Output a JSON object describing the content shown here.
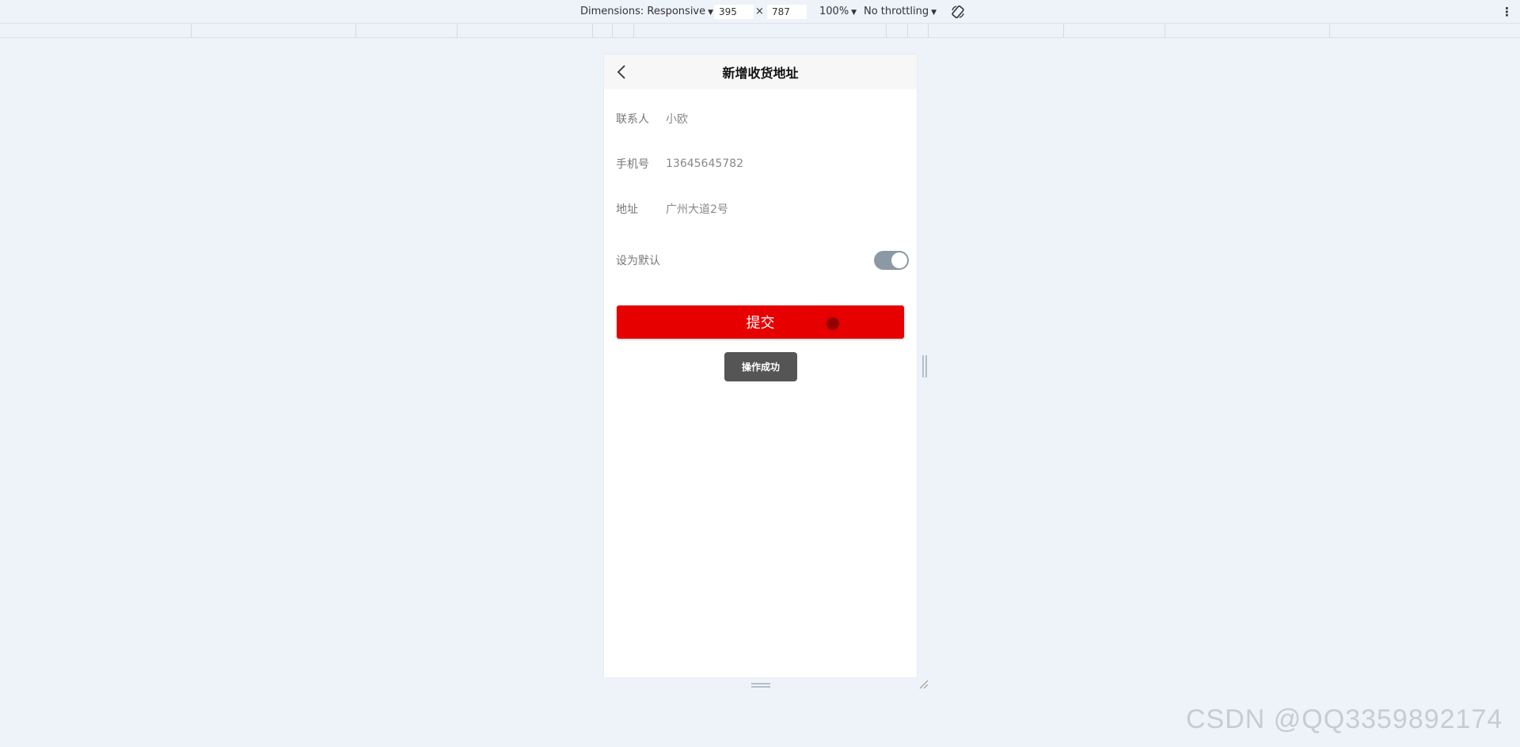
{
  "devtools": {
    "dimensions_label": "Dimensions: Responsive",
    "width": "395",
    "times": "×",
    "height": "787",
    "zoom": "100%",
    "throttling": "No throttling"
  },
  "page": {
    "title": "新增收货地址",
    "fields": [
      {
        "label": "联系人",
        "value": "小欧"
      },
      {
        "label": "手机号",
        "value": "13645645782"
      },
      {
        "label": "地址",
        "value": "广州大道2号"
      }
    ],
    "default_switch": {
      "label": "设为默认",
      "on": true
    },
    "submit_label": "提交",
    "toast": "操作成功"
  },
  "watermark": "CSDN @QQ3359892174",
  "colors": {
    "accent": "#e60000",
    "toggle_on": "#8a99a4",
    "toast_bg": "#555555",
    "background": "#eef2f9"
  }
}
